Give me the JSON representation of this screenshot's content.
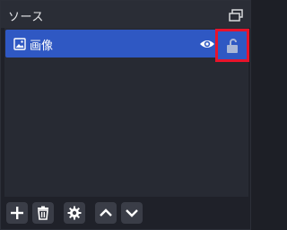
{
  "panel": {
    "title": "ソース"
  },
  "sources": [
    {
      "name": "画像",
      "icon": "image-icon",
      "visible": true,
      "locked": false
    }
  ],
  "toolbar": {
    "buttons": [
      "add-icon",
      "trash-icon",
      "gear-icon",
      "chevron-up-icon",
      "chevron-down-icon"
    ]
  },
  "colors": {
    "selection": "#2f58c3",
    "highlight": "#e8132b",
    "background": "#1f2129"
  }
}
